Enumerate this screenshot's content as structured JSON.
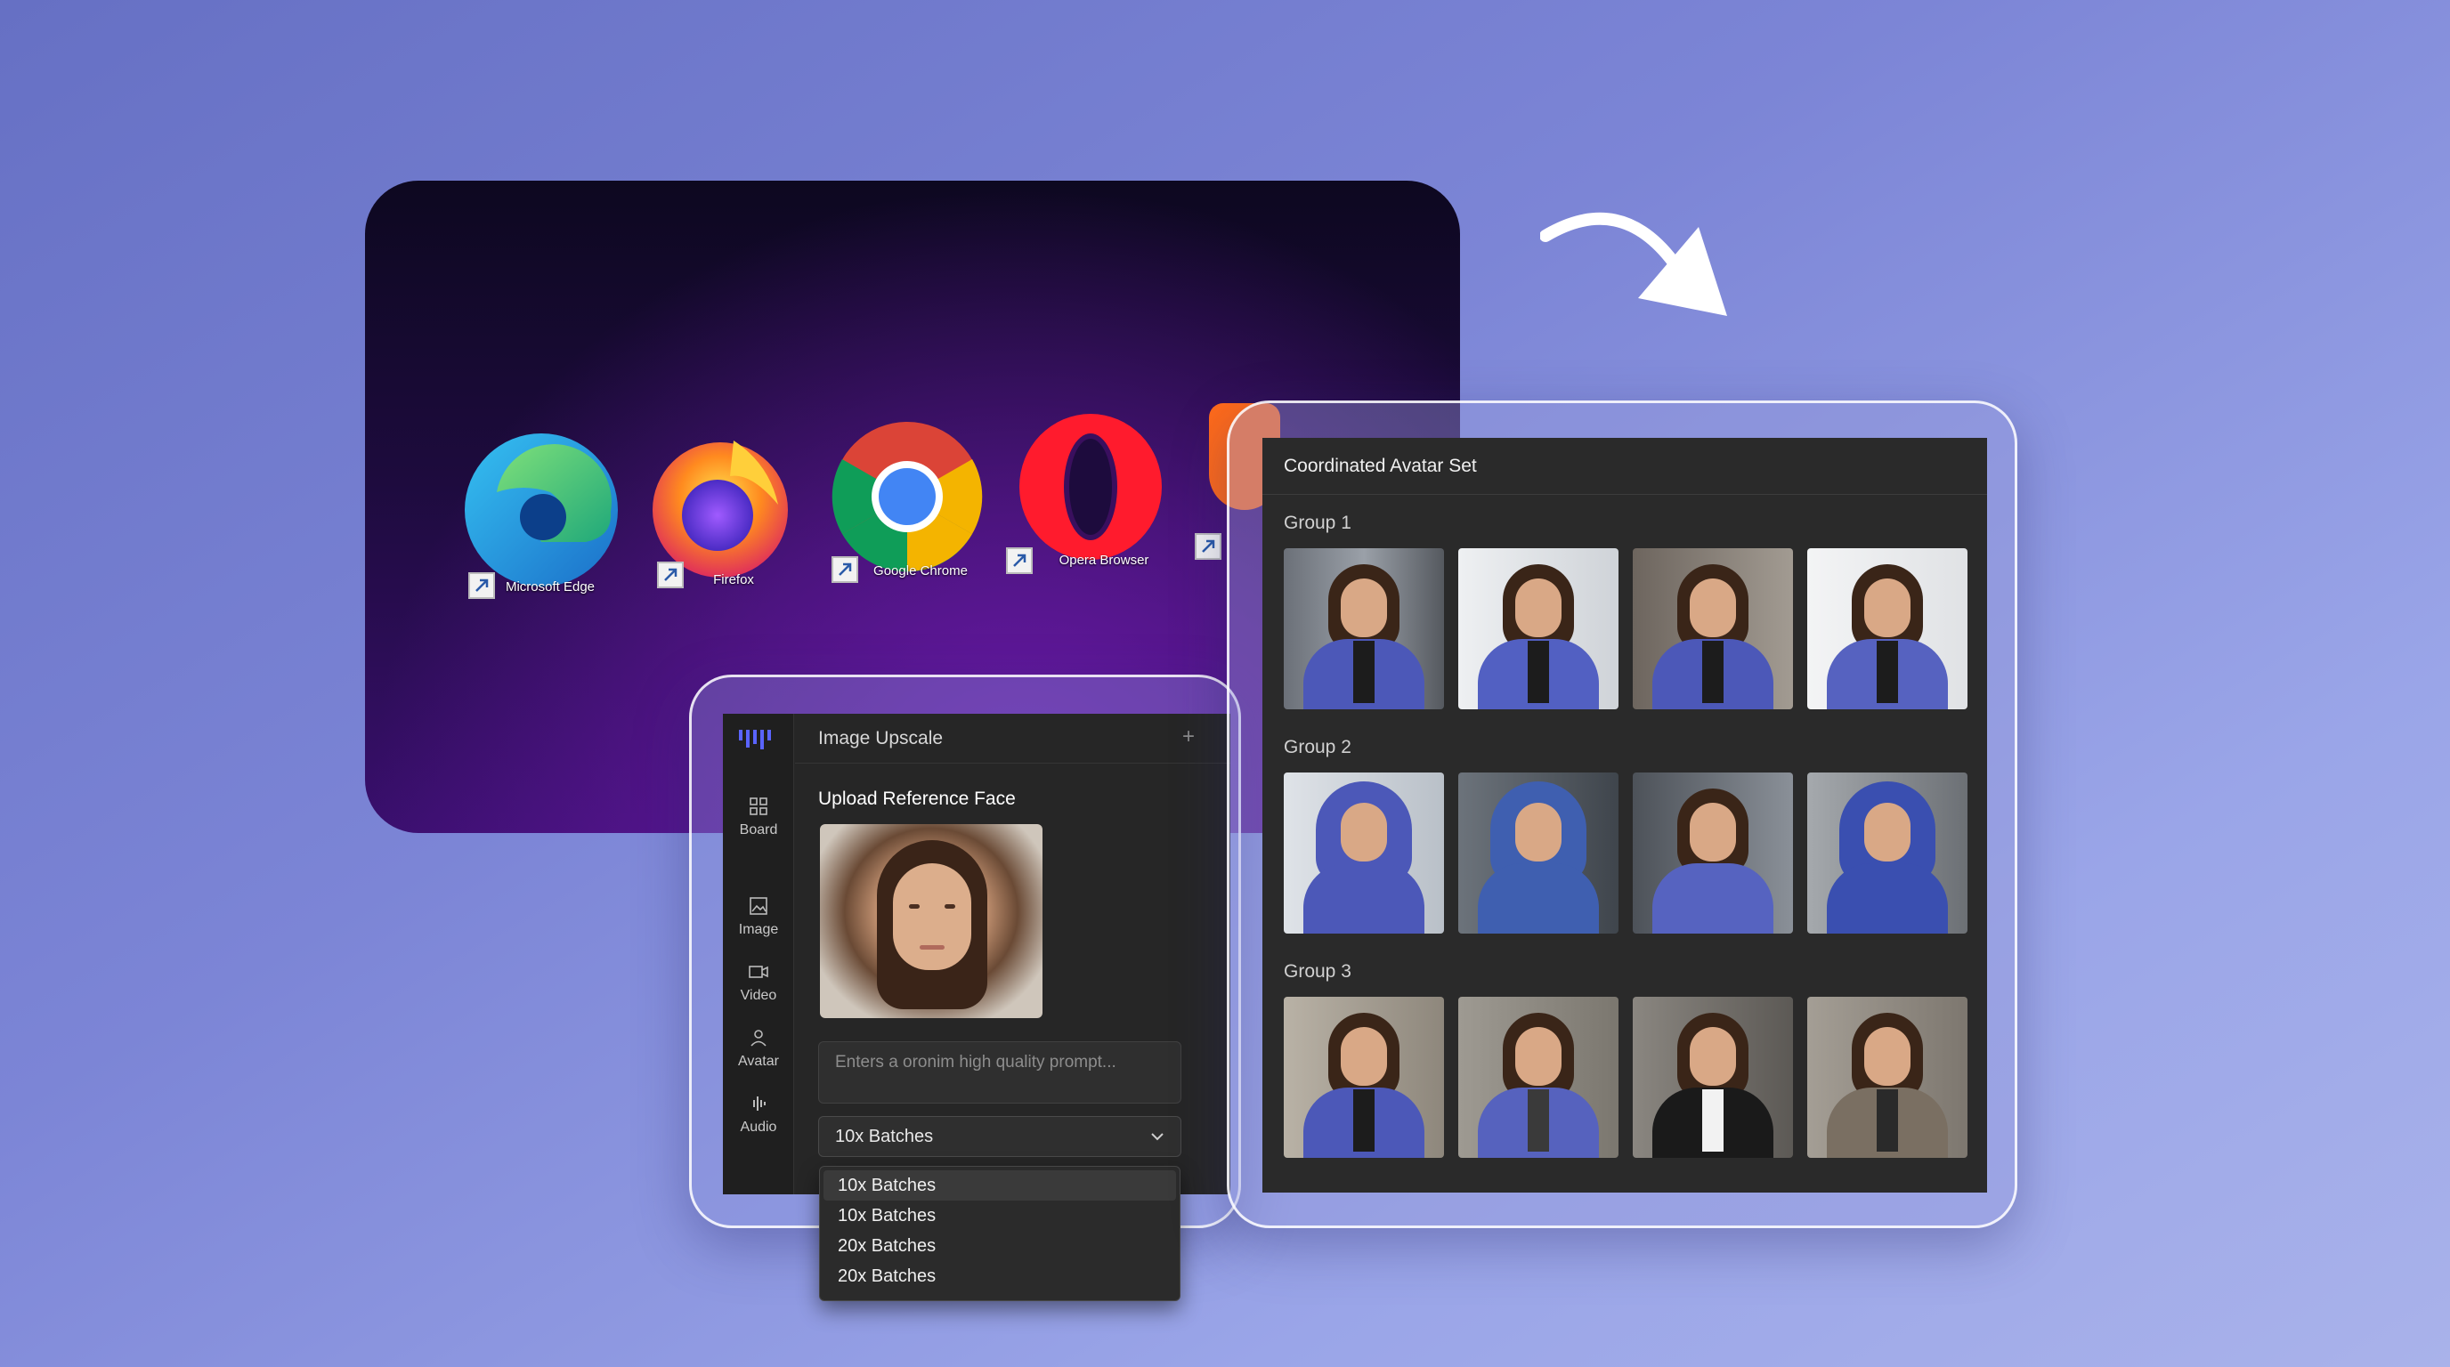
{
  "desktop": {
    "icons": [
      {
        "label": "Microsoft Edge",
        "icon": "edge-icon"
      },
      {
        "label": "Firefox",
        "icon": "firefox-icon"
      },
      {
        "label": "Google Chrome",
        "icon": "chrome-icon"
      },
      {
        "label": "Opera Browser",
        "icon": "opera-icon"
      }
    ]
  },
  "app": {
    "title": "Image Upscale",
    "plus_symbol": "+",
    "nav": [
      {
        "label": "Board",
        "icon": "grid-icon"
      },
      {
        "label": "Image",
        "icon": "image-icon"
      },
      {
        "label": "Video",
        "icon": "video-icon"
      },
      {
        "label": "Avatar",
        "icon": "person-icon"
      },
      {
        "label": "Audio",
        "icon": "waveform-icon"
      }
    ],
    "upload_title": "Upload Reference Face",
    "prompt_placeholder": "Enters a oronim high quality prompt...",
    "batch_select": {
      "value": "10x Batches",
      "options": [
        "10x Batches",
        "10x Batches",
        "20x Batches",
        "20x Batches"
      ]
    }
  },
  "avatar_set": {
    "title": "Coordinated Avatar Set",
    "groups": [
      {
        "label": "Group 1",
        "outfit": "blue blazer"
      },
      {
        "label": "Group 2",
        "outfit": "blue hoodie"
      },
      {
        "label": "Group 3",
        "outfit": "business suit"
      }
    ]
  },
  "colors": {
    "accent_blue": "#4c58b8",
    "background_top": "#6670c4",
    "background_bottom": "#a9b2ea"
  }
}
